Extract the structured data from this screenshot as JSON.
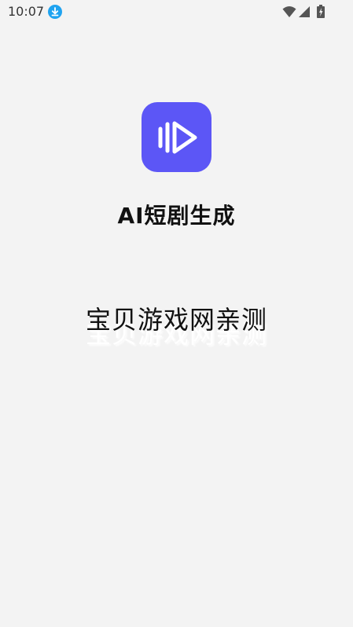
{
  "status_bar": {
    "time": "10:07",
    "icons": [
      "download-icon",
      "wifi-icon",
      "signal-icon",
      "battery-icon"
    ]
  },
  "app": {
    "name": "AI短剧生成",
    "logo_icon": "play-icon",
    "logo_color": "#5c56f6"
  },
  "watermark": {
    "text": "宝贝游戏网亲测"
  },
  "colors": {
    "background": "#f3f3f3",
    "download_icon": "#1fa3f0"
  }
}
